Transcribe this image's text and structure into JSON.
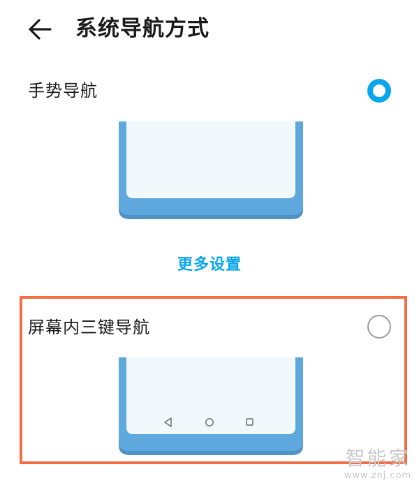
{
  "header": {
    "title": "系统导航方式",
    "back_icon": "arrow-left-icon"
  },
  "options": [
    {
      "label": "手势导航",
      "selected": true,
      "preview_style": "gesture"
    },
    {
      "label": "屏幕内三键导航",
      "selected": false,
      "preview_style": "three-key"
    }
  ],
  "more_settings_label": "更多设置",
  "colors": {
    "accent": "#0aa6ec",
    "phone_frame": "#5fa8dd",
    "phone_frame_bottom": "#4f92c6",
    "phone_screen": "#f2f9fc",
    "highlight_border": "#f26d43"
  },
  "nav_keys": [
    "triangle-back-icon",
    "circle-home-icon",
    "square-recent-icon"
  ],
  "watermark": {
    "logo": "智能家",
    "url": "www.znj.com"
  }
}
